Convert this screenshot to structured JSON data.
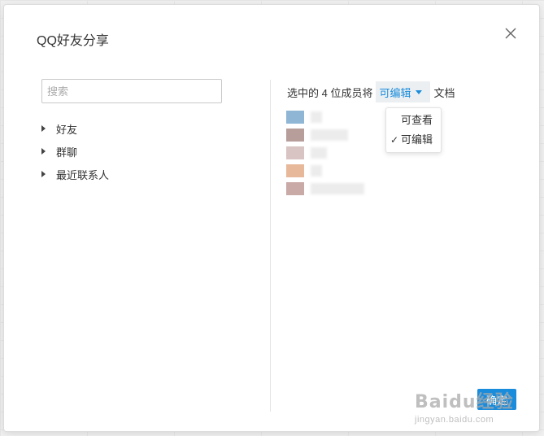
{
  "dialog": {
    "title": "QQ好友分享",
    "close_icon": "close-icon"
  },
  "search": {
    "placeholder": "搜索",
    "value": ""
  },
  "tree": {
    "items": [
      {
        "label": "好友"
      },
      {
        "label": "群聊"
      },
      {
        "label": "最近联系人"
      }
    ]
  },
  "permission": {
    "prefix": "选中的 4 位成员将",
    "selected": "可编辑",
    "suffix": "文档",
    "options": [
      {
        "label": "可查看",
        "checked": false
      },
      {
        "label": "可编辑",
        "checked": true
      }
    ]
  },
  "members": [
    {
      "avatar_color": "#8fb6d4",
      "name_blurred": true
    },
    {
      "avatar_color": "#b89e9a",
      "name_blurred": true
    },
    {
      "avatar_color": "#d8c4c2",
      "name_blurred": true
    },
    {
      "avatar_color": "#e8b89a",
      "name_blurred": true
    },
    {
      "avatar_color": "#c9aaa6",
      "name_blurred": true
    }
  ],
  "actions": {
    "confirm_label": "确定"
  },
  "watermark": {
    "logo": "Baidu经验",
    "url": "jingyan.baidu.com"
  },
  "colors": {
    "accent": "#1a8cdc",
    "dialog_bg": "#ffffff",
    "page_bg": "#f0f0f0"
  }
}
